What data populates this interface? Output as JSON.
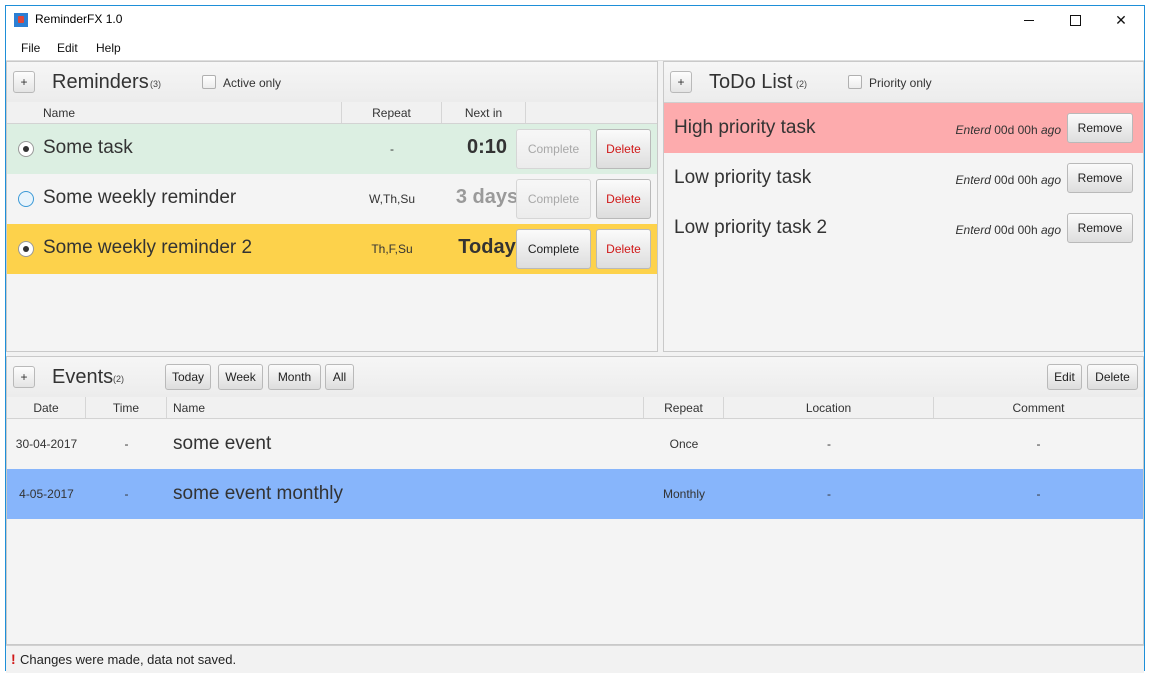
{
  "window": {
    "title": "ReminderFX 1.0"
  },
  "menu": [
    "File",
    "Edit",
    "Help"
  ],
  "reminders": {
    "title": "Reminders",
    "count": "(3)",
    "add_label": "+",
    "filter_label": "Active only",
    "columns": [
      "Name",
      "Repeat",
      "Next in"
    ],
    "rows": [
      {
        "name": "Some task",
        "repeat": "-",
        "next_in": "0:10",
        "complete": "Complete",
        "delete": "Delete",
        "bg": "#dcefe2",
        "radio": "filled",
        "complete_enabled": false
      },
      {
        "name": "Some weekly reminder",
        "repeat": "W,Th,Su",
        "next_in": "3 days",
        "complete": "Complete",
        "delete": "Delete",
        "bg": "#f4f4f4",
        "radio": "empty",
        "complete_enabled": false
      },
      {
        "name": "Some weekly reminder 2",
        "repeat": "Th,F,Su",
        "next_in": "Today",
        "complete": "Complete",
        "delete": "Delete",
        "bg": "#fdd24b",
        "radio": "filled",
        "complete_enabled": true
      }
    ]
  },
  "todo": {
    "title": "ToDo List",
    "count": "(2)",
    "add_label": "+",
    "filter_label": "Priority only",
    "rows": [
      {
        "name": "High priority task",
        "entered_prefix": "Enterd",
        "entered_time": "00d 00h",
        "entered_suffix": "ago",
        "remove": "Remove",
        "bg": "#fdabad"
      },
      {
        "name": "Low priority task",
        "entered_prefix": "Enterd",
        "entered_time": "00d 00h",
        "entered_suffix": "ago",
        "remove": "Remove",
        "bg": "#f4f4f4"
      },
      {
        "name": "Low priority task 2",
        "entered_prefix": "Enterd",
        "entered_time": "00d 00h",
        "entered_suffix": "ago",
        "remove": "Remove",
        "bg": "#f4f4f4"
      }
    ]
  },
  "events": {
    "title": "Events",
    "count": "(2)",
    "add_label": "+",
    "filters": [
      "Today",
      "Week",
      "Month",
      "All"
    ],
    "edit_label": "Edit",
    "delete_label": "Delete",
    "columns": [
      "Date",
      "Time",
      "Name",
      "Repeat",
      "Location",
      "Comment"
    ],
    "rows": [
      {
        "date": "30-04-2017",
        "time": "-",
        "name": "some event",
        "repeat": "Once",
        "location": "-",
        "comment": "-",
        "bg": "#f4f4f4"
      },
      {
        "date": "4-05-2017",
        "time": "-",
        "name": "some event monthly",
        "repeat": "Monthly",
        "location": "-",
        "comment": "-",
        "bg": "#87b5fb"
      }
    ]
  },
  "status": {
    "icon_text": "!",
    "message": "Changes were made, data not saved."
  },
  "colors": {
    "accent": "#1e8fd8",
    "status_icon": "#d01818"
  }
}
